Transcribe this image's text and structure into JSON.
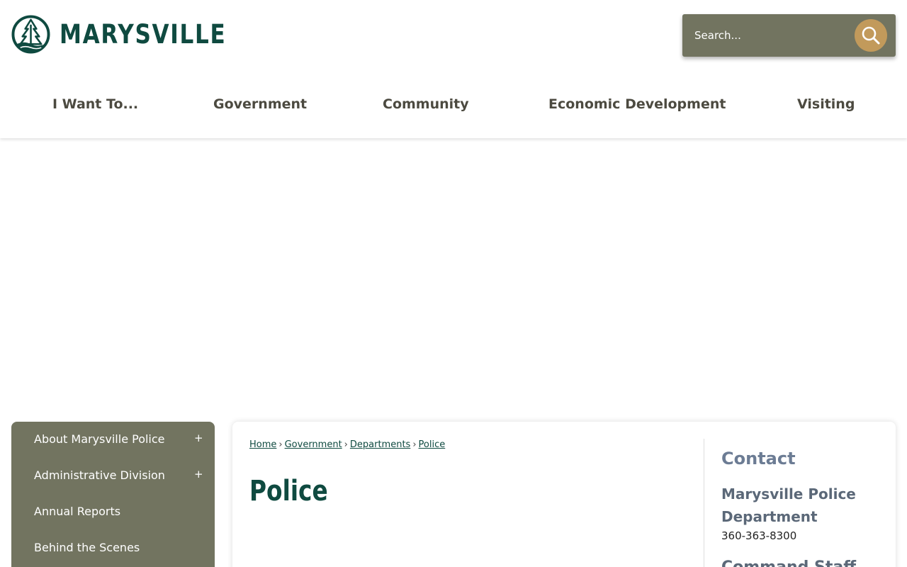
{
  "header": {
    "logo_text": "MARYSVILLE",
    "logo_icon": "tree-over-water-icon",
    "search": {
      "placeholder": "Search...",
      "icon": "search-icon"
    },
    "nav": [
      {
        "label": "I Want To..."
      },
      {
        "label": "Government"
      },
      {
        "label": "Community"
      },
      {
        "label": "Economic Development"
      },
      {
        "label": "Visiting"
      }
    ]
  },
  "sidebar": {
    "items": [
      {
        "label": "About Marysville Police",
        "toggle": "+"
      },
      {
        "label": "Administrative Division",
        "toggle": "+"
      },
      {
        "label": "Annual Reports",
        "toggle": ""
      },
      {
        "label": "Behind the Scenes",
        "toggle": ""
      }
    ]
  },
  "breadcrumb": {
    "items": [
      {
        "label": "Home"
      },
      {
        "label": "Government"
      },
      {
        "label": "Departments"
      },
      {
        "label": "Police"
      }
    ],
    "separator": "›"
  },
  "main": {
    "title": "Police"
  },
  "contact": {
    "heading": "Contact",
    "name": "Marysville Police Department",
    "phone": "360-363-8300",
    "next_heading_partial": "Command Staff"
  },
  "colors": {
    "brand_green": "#0f4a40",
    "olive": "#727460",
    "gold": "#c29a5b",
    "slate": "#6c7c94"
  }
}
